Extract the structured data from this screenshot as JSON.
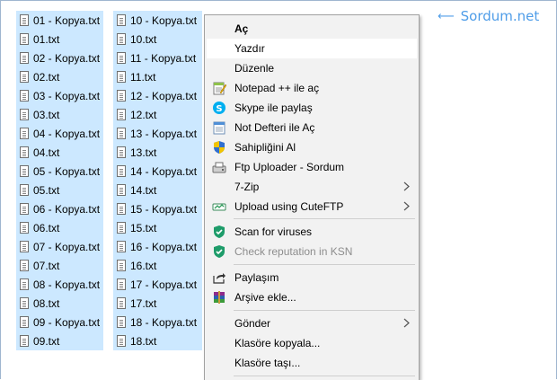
{
  "watermark": {
    "text": "Sordum.net",
    "color": "#4f9de8"
  },
  "files_col1": [
    "01 - Kopya.txt",
    "01.txt",
    "02 - Kopya.txt",
    "02.txt",
    "03 - Kopya.txt",
    "03.txt",
    "04 - Kopya.txt",
    "04.txt",
    "05 - Kopya.txt",
    "05.txt",
    "06 - Kopya.txt",
    "06.txt",
    "07 - Kopya.txt",
    "07.txt",
    "08 - Kopya.txt",
    "08.txt",
    "09 - Kopya.txt",
    "09.txt"
  ],
  "files_col2": [
    "10 - Kopya.txt",
    "10.txt",
    "11 - Kopya.txt",
    "11.txt",
    "12 - Kopya.txt",
    "12.txt",
    "13 - Kopya.txt",
    "13.txt",
    "14 - Kopya.txt",
    "14.txt",
    "15 - Kopya.txt",
    "15.txt",
    "16 - Kopya.txt",
    "16.txt",
    "17 - Kopya.txt",
    "17.txt",
    "18 - Kopya.txt",
    "18.txt"
  ],
  "selection_color": "#cce8ff",
  "context_menu": {
    "items": [
      {
        "label": "Aç",
        "bold": true,
        "icon": "none"
      },
      {
        "label": "Yazdır",
        "hover": true,
        "icon": "none"
      },
      {
        "label": "Düzenle",
        "icon": "none"
      },
      {
        "label": "Notepad ++ ile aç",
        "icon": "notepadpp-icon"
      },
      {
        "label": "Skype ile paylaş",
        "icon": "skype-icon"
      },
      {
        "label": "Not Defteri ile Aç",
        "icon": "notepad-icon"
      },
      {
        "label": "Sahipliğini Al",
        "icon": "uac-shield-icon"
      },
      {
        "label": "Ftp Uploader - Sordum",
        "icon": "ftp-uploader-icon"
      },
      {
        "label": "7-Zip",
        "icon": "none",
        "submenu": true
      },
      {
        "label": "Upload using CuteFTP",
        "icon": "cuteftp-icon",
        "submenu": true
      },
      {
        "label": "Scan for viruses",
        "icon": "kaspersky-shield-icon"
      },
      {
        "label": "Check reputation in KSN",
        "icon": "kaspersky-shield-icon",
        "disabled": true
      },
      {
        "label": "Paylaşım",
        "icon": "share-icon"
      },
      {
        "label": "Arşive ekle...",
        "icon": "winrar-icon"
      },
      {
        "label": "Gönder",
        "icon": "none",
        "submenu": true
      },
      {
        "label": "Klasöre kopyala...",
        "icon": "none"
      },
      {
        "label": "Klasöre taşı...",
        "icon": "none"
      }
    ]
  }
}
